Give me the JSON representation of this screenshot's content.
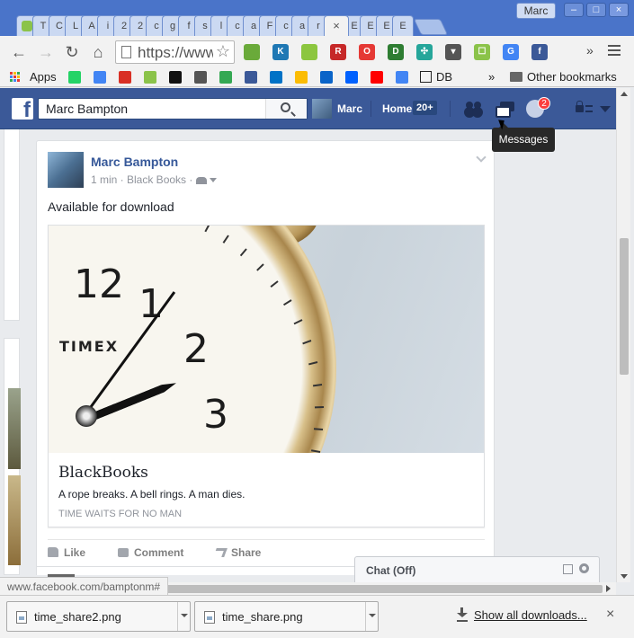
{
  "browser": {
    "tab_letters": [
      "T",
      "C",
      "L",
      "A",
      "i",
      "2",
      "2",
      "c",
      "g",
      "f",
      "s",
      "l",
      "c",
      "a",
      "F",
      "c",
      "a",
      "r",
      "l"
    ],
    "tab_letters_after": [
      "E",
      "E",
      "E",
      "E"
    ],
    "active_tab_close": "×",
    "profile_name": "Marc",
    "window_buttons": [
      "–",
      "□",
      "×"
    ],
    "url": "https://www.facebook.com/",
    "back": "←",
    "forward": "→",
    "reload": "↻",
    "home": "⌂",
    "star": "☆",
    "more_extensions": "»",
    "extension_icons": [
      {
        "name": "evernote-icon",
        "color": "#6aaa3a",
        "glyph": ""
      },
      {
        "name": "klout-icon",
        "color": "#1f78b4",
        "glyph": "K"
      },
      {
        "name": "green-dot-icon",
        "color": "#8cc63f",
        "glyph": ""
      },
      {
        "name": "rbutr-icon",
        "color": "#c62828",
        "glyph": "R"
      },
      {
        "name": "opera-icon",
        "color": "#e53935",
        "glyph": "O"
      },
      {
        "name": "pushbullet-icon",
        "color": "#2e7d32",
        "glyph": "D"
      },
      {
        "name": "network-icon",
        "color": "#26a69a",
        "glyph": "✣"
      },
      {
        "name": "pocket-icon",
        "color": "#555555",
        "glyph": "▾"
      },
      {
        "name": "hangouts-icon",
        "color": "#8bc34a",
        "glyph": "☐"
      },
      {
        "name": "google-translate-icon",
        "color": "#4285f4",
        "glyph": "G"
      },
      {
        "name": "facebook-ext-icon",
        "color": "#3b5998",
        "glyph": "f"
      }
    ]
  },
  "bookmarks": {
    "apps_label": "Apps",
    "db_label": "DB",
    "more": "»",
    "other_label": "Other bookmarks",
    "icons": [
      {
        "name": "whatsapp-icon",
        "color": "#25d366"
      },
      {
        "name": "calendar-icon",
        "color": "#4285f4"
      },
      {
        "name": "gmail-icon",
        "color": "#d93025"
      },
      {
        "name": "hangouts-bm-icon",
        "color": "#8bc34a"
      },
      {
        "name": "terminal-icon",
        "color": "#111111"
      },
      {
        "name": "folder-bm-icon",
        "color": "#555555"
      },
      {
        "name": "maps-icon",
        "color": "#34a853"
      },
      {
        "name": "facebook-bm-icon",
        "color": "#3b5998"
      },
      {
        "name": "outlook-icon",
        "color": "#0072c6"
      },
      {
        "name": "drive-icon",
        "color": "#fbbc04"
      },
      {
        "name": "onedrive-icon",
        "color": "#0a64c8"
      },
      {
        "name": "dropbox-icon",
        "color": "#0061fe"
      },
      {
        "name": "youtube-icon",
        "color": "#ff0000"
      },
      {
        "name": "translate-bm-icon",
        "color": "#4285f4"
      }
    ]
  },
  "facebook": {
    "search_value": "Marc Bampton",
    "user_name": "Marc",
    "home_label": "Home",
    "home_count": "20+",
    "notifications_count": "2",
    "tooltip": "Messages"
  },
  "post": {
    "author": "Marc Bampton",
    "meta": "1 min · Black Books ·",
    "text": "Available for download",
    "link": {
      "image_brand": "TIMEX",
      "clock_numbers": [
        "12",
        "1",
        "2",
        "3"
      ],
      "title": "BlackBooks",
      "description": "A rope breaks. A bell rings. A man dies.",
      "domain": "TIME WAITS FOR NO MAN"
    },
    "actions": {
      "like": "Like",
      "comment": "Comment",
      "share": "Share"
    }
  },
  "chat": {
    "label": "Chat (Off)"
  },
  "status_bar": {
    "url": "www.facebook.com/bamptonm#"
  },
  "downloads": {
    "items": [
      {
        "name": "time_share2.png"
      },
      {
        "name": "time_share.png"
      }
    ],
    "show_all": "Show all downloads...",
    "close": "×"
  }
}
